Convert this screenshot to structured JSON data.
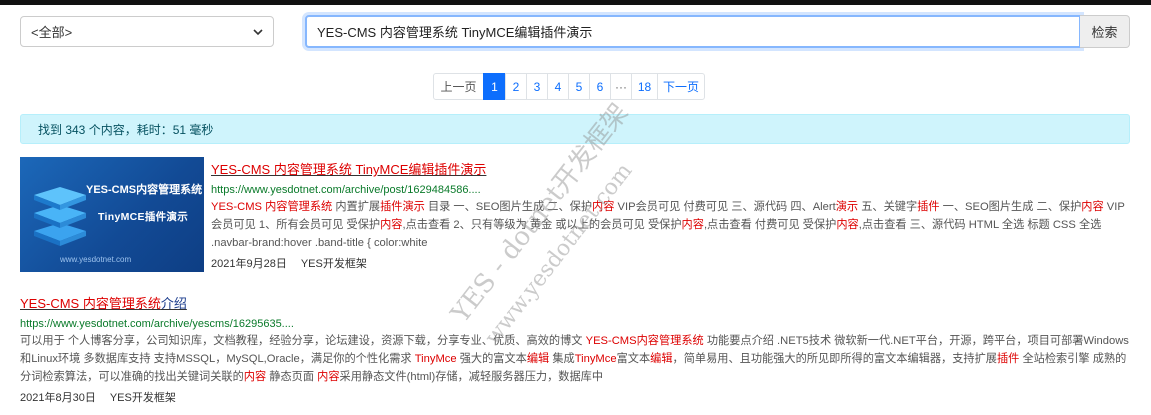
{
  "filter": {
    "selected": "<全部>"
  },
  "search": {
    "value": "YES-CMS 内容管理系统 TinyMCE编辑插件演示",
    "button": "检索"
  },
  "pagination": {
    "prev": "上一页",
    "pages": [
      "1",
      "2",
      "3",
      "4",
      "5",
      "6"
    ],
    "ellipsis": "···",
    "last": "18",
    "next": "下一页",
    "current": "1"
  },
  "summary": "找到 343 个内容，耗时：51 毫秒",
  "results": [
    {
      "title_parts": [
        "YES-CMS 内容管理系统 TinyMCE编辑插件演示"
      ],
      "url": "https://www.yesdotnet.com/archive/post/1629484586....",
      "thumb": {
        "line1": "YES-CMS内容管理系统",
        "line2": "TinyMCE插件演示",
        "line3": "www.yesdotnet.com"
      },
      "desc": [
        {
          "t": "YES-CMS 内容管理系统",
          "h": true
        },
        {
          "t": " 内置扩展",
          "h": false
        },
        {
          "t": "插件演示",
          "h": true
        },
        {
          "t": " 目录 一、SEO图片生成 二、保护",
          "h": false
        },
        {
          "t": "内容",
          "h": true
        },
        {
          "t": " VIP会员可见 付费可见 三、源代码 四、Alert",
          "h": false
        },
        {
          "t": "演示",
          "h": true
        },
        {
          "t": " 五、关键字",
          "h": false
        },
        {
          "t": "插件",
          "h": true
        },
        {
          "t": " 一、SEO图片生成 二、保护",
          "h": false
        },
        {
          "t": "内容",
          "h": true
        },
        {
          "t": " VIP会员可见 1、所有会员可见 受保护",
          "h": false
        },
        {
          "t": "内容",
          "h": true
        },
        {
          "t": ",点击查看 2、只有等级为 黄金  或以上的会员可见 受保护",
          "h": false
        },
        {
          "t": "内容",
          "h": true
        },
        {
          "t": ",点击查看   付费可见 受保护",
          "h": false
        },
        {
          "t": "内容",
          "h": true
        },
        {
          "t": ",点击查看   三、源代码 HTML 全选 标题   CSS 全选 .navbar-brand:hover .band-title { color:white",
          "h": false
        }
      ],
      "date": "2021年9月28日",
      "author": "YES开发框架"
    },
    {
      "title_hl": "YES-CMS 内容管理系统",
      "title_rest": "介绍",
      "url": "https://www.yesdotnet.com/archive/yescms/16295635....",
      "desc": [
        {
          "t": "可以用于 个人博客分享，公司知识库，文档教程，经验分享，论坛建设，资源下载，分享专业、优质、高效的博文 ",
          "h": false
        },
        {
          "t": "YES-CMS内容管理系统",
          "h": true
        },
        {
          "t": " 功能要点介绍 .NET5技术 微软新一代.NET平台，开源，跨平台，项目可部署Windows和Linux环境 多数据库支持 支持MSSQL，MySQL,Oracle，满足你的个性化需求 ",
          "h": false
        },
        {
          "t": "TinyMce",
          "h": true
        },
        {
          "t": " 强大的富文本",
          "h": false
        },
        {
          "t": "编辑",
          "h": true
        },
        {
          "t": " 集成",
          "h": false
        },
        {
          "t": "TinyMce",
          "h": true
        },
        {
          "t": "富文本",
          "h": false
        },
        {
          "t": "编辑",
          "h": true
        },
        {
          "t": "，简单易用、且功能强大的所见即所得的富文本编辑器，支持扩展",
          "h": false
        },
        {
          "t": "插件",
          "h": true
        },
        {
          "t": " 全站检索引擎 成熟的分词检索算法，可以准确的找出关键词关联的",
          "h": false
        },
        {
          "t": "内容",
          "h": true
        },
        {
          "t": " 静态页面 ",
          "h": false
        },
        {
          "t": "内容",
          "h": true
        },
        {
          "t": "采用静态文件(html)存储，减轻服务器压力，数据库中",
          "h": false
        }
      ],
      "date": "2021年8月30日",
      "author": "YES开发框架"
    }
  ],
  "watermark": {
    "line1": "YES - dotnet开发框架",
    "line2": "www.yesdotnet.com"
  },
  "colors": {
    "primary": "#0d6efd",
    "highlight": "#dd0000",
    "url_green": "#0a7a2a",
    "notice_bg": "#cff4fc"
  }
}
